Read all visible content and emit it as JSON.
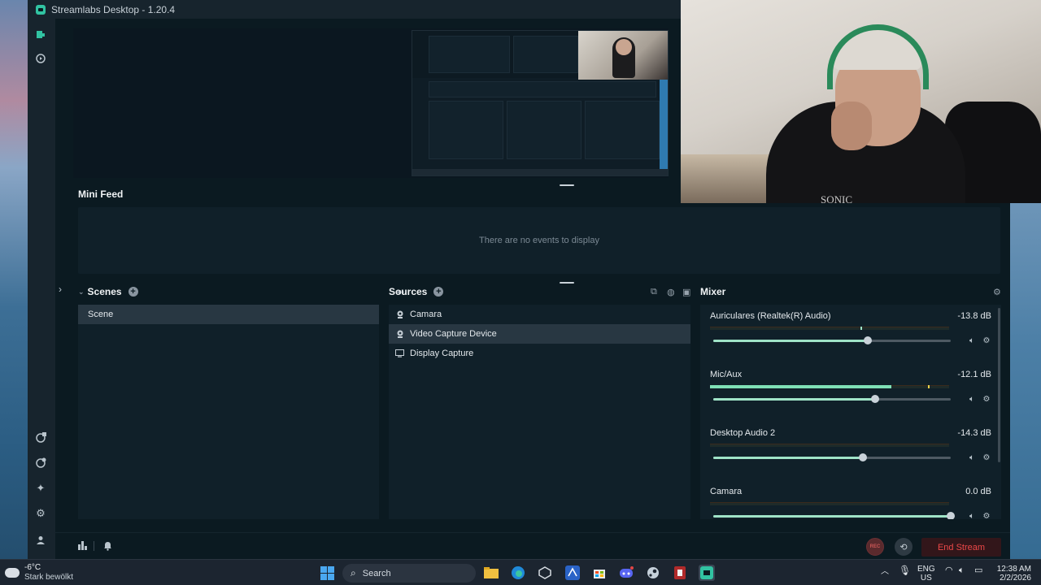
{
  "window": {
    "title": "Streamlabs Desktop - 1.20.4"
  },
  "sidebar": {
    "top_icons": [
      "editor-icon",
      "record-icon"
    ],
    "bottom_icons": [
      "game-overlay-icon",
      "themes-icon",
      "ai-highlighter-icon",
      "settings-icon",
      "login-icon"
    ]
  },
  "mini_feed": {
    "title": "Mini Feed",
    "empty_text": "There are no events to display"
  },
  "scenes": {
    "title": "Scenes",
    "items": [
      "Scene"
    ],
    "selected": "Scene"
  },
  "sources": {
    "title": "Sources",
    "items": [
      "Camara",
      "Video Capture Device",
      "Display Capture"
    ],
    "selected": "Video Capture Device"
  },
  "mixer": {
    "title": "Mixer",
    "channels": [
      {
        "name": "Auriculares (Realtek(R) Audio)",
        "db": "-13.8 dB",
        "volume": 0.65,
        "meter": 0.0
      },
      {
        "name": "Mic/Aux",
        "db": "-12.1 dB",
        "volume": 0.68,
        "meter": 0.76
      },
      {
        "name": "Desktop Audio 2",
        "db": "-14.3 dB",
        "volume": 0.63,
        "meter": 0.0
      },
      {
        "name": "Camara",
        "db": "0.0 dB",
        "volume": 1.0,
        "meter": 0.0
      }
    ]
  },
  "bottom_bar": {
    "rec_label": "REC",
    "end_stream_label": "End Stream"
  },
  "webcam": {
    "shirt_text": "SONIC"
  },
  "taskbar": {
    "weather_temp": "-6°C",
    "weather_desc": "Stark bewölkt",
    "search_label": "Search",
    "lang_line1": "ENG",
    "lang_line2": "US",
    "time": "12:38 AM",
    "date": "2/2/2026"
  },
  "colors": {
    "accent": "#31c3a2",
    "end_stream": "#ec4848",
    "slider_fill": "#9fe3c7",
    "background": "#0b1a21"
  }
}
